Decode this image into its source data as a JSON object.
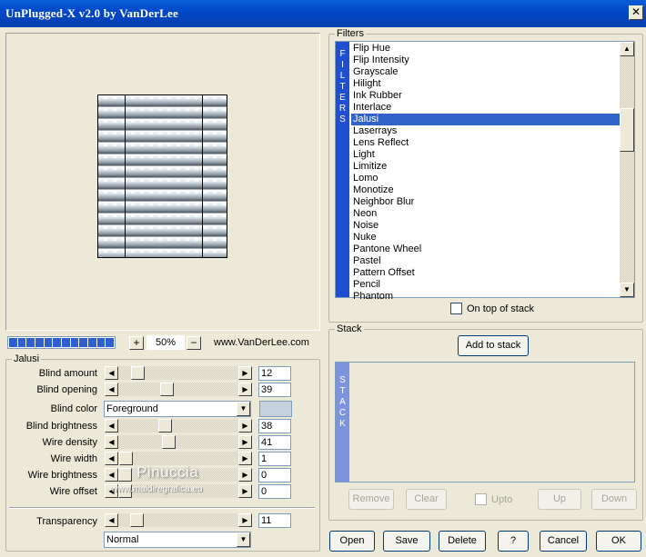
{
  "window": {
    "title": "UnPlugged-X v2.0 by VanDerLee",
    "close_glyph": "✕"
  },
  "preview": {
    "zoom": "50%",
    "zoom_in_glyph": "+",
    "zoom_out_glyph": "−",
    "url": "www.VanDerLee.com",
    "progress_fraction": 1.0
  },
  "jalusi": {
    "legend": "Jalusi",
    "sliders": [
      {
        "label": "Blind amount",
        "value": "12",
        "fraction": 0.12
      },
      {
        "label": "Blind opening",
        "value": "39",
        "fraction": 0.39
      },
      {
        "label": "Blind brightness",
        "value": "38",
        "fraction": 0.38
      },
      {
        "label": "Wire density",
        "value": "41",
        "fraction": 0.41
      },
      {
        "label": "Wire width",
        "value": "1",
        "fraction": 0.01
      },
      {
        "label": "Wire brightness",
        "value": "0",
        "fraction": 0.0
      },
      {
        "label": "Wire offset",
        "value": "0",
        "fraction": 0.0
      }
    ],
    "blind_color": {
      "label": "Blind color",
      "value": "Foreground",
      "swatch": "#c5d2de"
    },
    "transparency": {
      "label": "Transparency",
      "value": "11",
      "fraction": 0.11
    },
    "blend_mode": "Normal"
  },
  "filters": {
    "legend": "Filters",
    "strip_text": [
      "F",
      "I",
      "L",
      "T",
      "E",
      "R",
      "S"
    ],
    "strip_color": "#1f4fd1",
    "items": [
      "Flip Hue",
      "Flip Intensity",
      "Grayscale",
      "Hilight",
      "Ink Rubber",
      "Interlace",
      "Jalusi",
      "Laserrays",
      "Lens Reflect",
      "Light",
      "Limitize",
      "Lomo",
      "Monotize",
      "Neighbor Blur",
      "Neon",
      "Noise",
      "Nuke",
      "Pantone Wheel",
      "Pastel",
      "Pattern Offset",
      "Pencil",
      "Phantom"
    ],
    "selected": "Jalusi",
    "on_top_label": "On top of stack"
  },
  "stack": {
    "legend": "Stack",
    "add_label": "Add to stack",
    "strip_text": [
      "S",
      "T",
      "A",
      "C",
      "K"
    ],
    "strip_color": "#7c93dd",
    "remove_label": "Remove",
    "clear_label": "Clear",
    "upto_label": "Upto",
    "up_label": "Up",
    "down_label": "Down"
  },
  "footer": {
    "open_label": "Open",
    "save_label": "Save",
    "delete_label": "Delete",
    "help_label": "?",
    "cancel_label": "Cancel",
    "ok_label": "OK"
  },
  "watermark": {
    "name": "Pinuccia",
    "site": "www.maidiregrafica.eu"
  }
}
